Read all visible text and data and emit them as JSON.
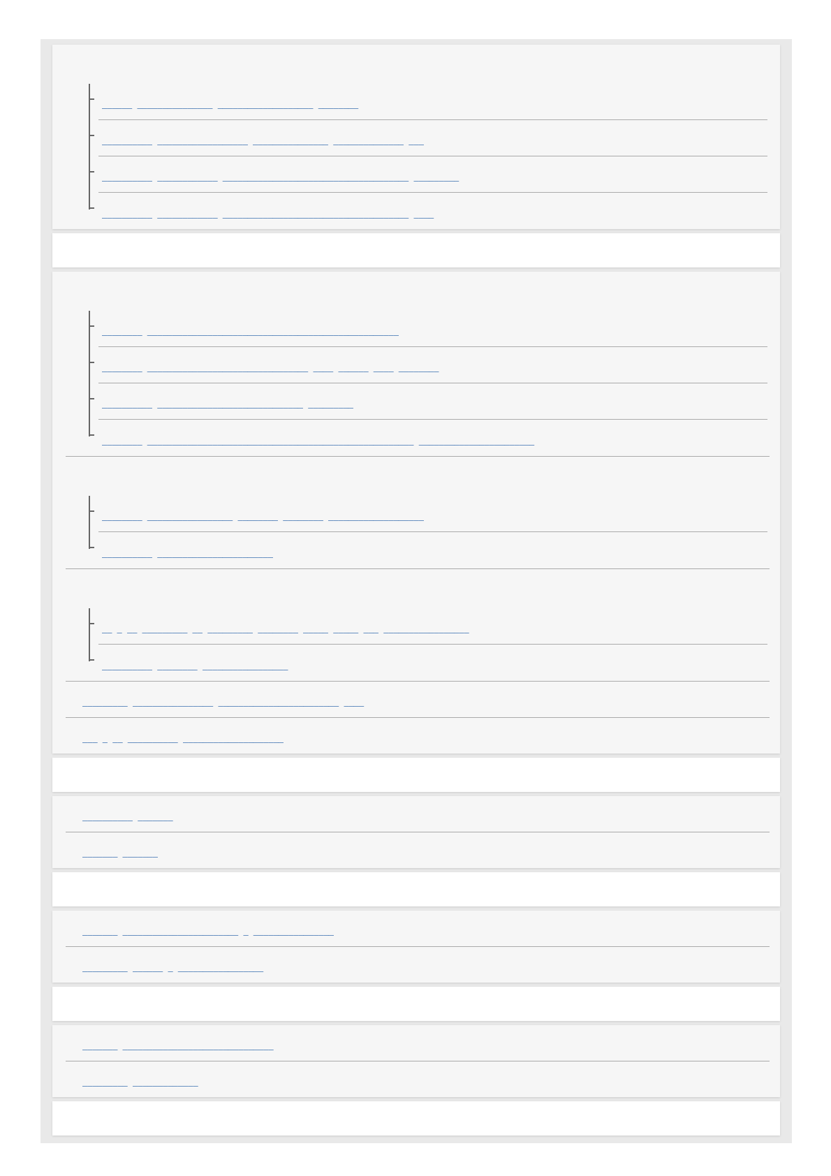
{
  "sections": [
    {
      "kind": "list",
      "groups": [
        {
          "kind": "tree",
          "links": [
            {
              "text": "______ _______________ ___________________ ________"
            },
            {
              "text": "__________ __________________ _______________ ______________ ___"
            },
            {
              "text": "__________ ____________ _____________________________________ _________"
            },
            {
              "text": "__________ ____________ _____________________________________ ____"
            }
          ]
        }
      ]
    },
    {
      "kind": "blank"
    },
    {
      "kind": "list",
      "groups": [
        {
          "kind": "tree",
          "links": [
            {
              "text": "________ __________________________________________________"
            },
            {
              "text": "________ ________________________________ ____ ______ ____ ________"
            },
            {
              "text": "__________ _____________________________ _________"
            },
            {
              "text": "________ _____________________________________________________ _______________________"
            }
          ]
        },
        {
          "kind": "tree",
          "links": [
            {
              "text": "________ _________________ ________ ________ ___________________"
            },
            {
              "text": "__________ _______________________"
            }
          ]
        },
        {
          "kind": "tree",
          "links": [
            {
              "text": "__ _ __ _________ __ _________ ________ _____ _____ ___ _________________"
            },
            {
              "text": "__________ ________ _________________"
            }
          ]
        },
        {
          "kind": "plain",
          "links": [
            {
              "text": "_________ ________________ ________________________ ____"
            }
          ]
        },
        {
          "kind": "plain",
          "links": [
            {
              "text": "___ _ __ __________ ____________________"
            }
          ]
        }
      ]
    },
    {
      "kind": "blank"
    },
    {
      "kind": "list",
      "groups": [
        {
          "kind": "plain",
          "links": [
            {
              "text": "__________ _______"
            }
          ]
        },
        {
          "kind": "plain",
          "links": [
            {
              "text": "_______ _______"
            }
          ]
        }
      ]
    },
    {
      "kind": "blank"
    },
    {
      "kind": "list",
      "groups": [
        {
          "kind": "plain",
          "links": [
            {
              "text": "_______ _______________________ _ ________________"
            }
          ]
        },
        {
          "kind": "plain",
          "links": [
            {
              "text": "_________ ______ _ _________________"
            }
          ]
        }
      ]
    },
    {
      "kind": "blank"
    },
    {
      "kind": "list",
      "groups": [
        {
          "kind": "plain",
          "links": [
            {
              "text": "_______ ______________________________"
            }
          ]
        },
        {
          "kind": "plain",
          "links": [
            {
              "text": "_________ _____________"
            }
          ]
        }
      ]
    },
    {
      "kind": "blank"
    }
  ]
}
